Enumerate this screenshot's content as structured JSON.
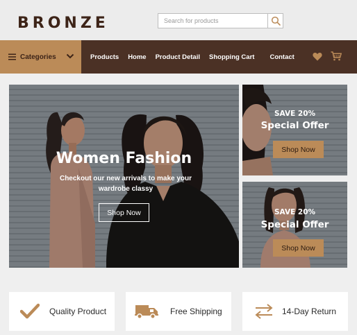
{
  "brand": {
    "name": "BRONZE"
  },
  "search": {
    "placeholder": "Search for products"
  },
  "nav": {
    "categories_label": "Categories",
    "links": [
      "Products",
      "Home",
      "Product Detail",
      "Shopping Cart",
      "Contact"
    ]
  },
  "hero": {
    "title": "Women Fashion",
    "subtitle": "Checkout our new arrivals to make your wardrobe classy",
    "button": "Shop Now"
  },
  "offers": [
    {
      "save": "SAVE 20%",
      "title": "Special Offer",
      "button": "Shop Now"
    },
    {
      "save": "SAVE 20%",
      "title": "Special Offer",
      "button": "Shop Now"
    }
  ],
  "features": [
    {
      "label": "Quality Product",
      "icon": "check-icon"
    },
    {
      "label": "Free Shipping",
      "icon": "truck-icon"
    },
    {
      "label": "14-Day Return",
      "icon": "exchange-arrows-icon"
    }
  ],
  "colors": {
    "accent": "#bb8b58",
    "nav_bg": "#4b3125",
    "brand_text": "#3d2418"
  }
}
